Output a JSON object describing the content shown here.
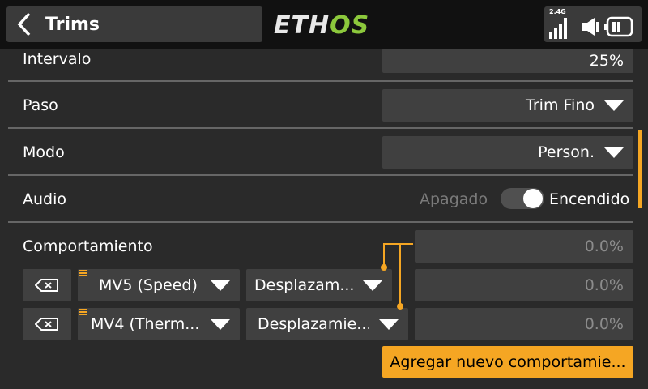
{
  "header": {
    "title": "Trims",
    "logo_part1": "ETH",
    "logo_part2": "OS",
    "rf_band": "2.4G"
  },
  "rows": {
    "intervalo": {
      "label": "Intervalo",
      "value": "25%"
    },
    "paso": {
      "label": "Paso",
      "value": "Trim Fino"
    },
    "modo": {
      "label": "Modo",
      "value": "Person."
    },
    "audio": {
      "label": "Audio",
      "off_label": "Apagado",
      "on_label": "Encendido",
      "state": "on"
    }
  },
  "comportamiento": {
    "label": "Comportamiento",
    "header_value": "0.0%",
    "items": [
      {
        "source": "MV5 (Speed)",
        "action": "Desplazam...",
        "value": "0.0%"
      },
      {
        "source": "MV4 (Therm...",
        "action": "Desplazamie...",
        "value": "0.0%"
      }
    ],
    "add_label": "Agregar nuevo comportamie..."
  },
  "colors": {
    "accent": "#f5a623",
    "logo_green": "#8cc83c",
    "background": "#2a2a2a"
  },
  "icons": [
    "chevron-left-icon",
    "signal-icon",
    "volume-icon",
    "battery-icon",
    "delete-icon",
    "caret-down-icon"
  ]
}
